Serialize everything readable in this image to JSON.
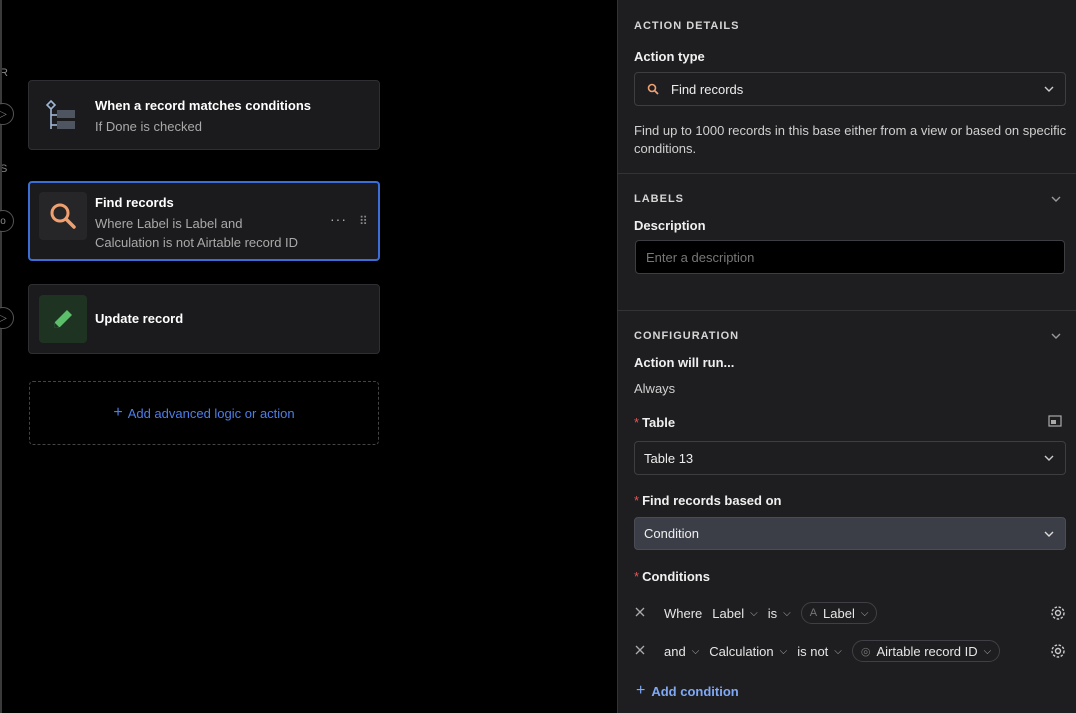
{
  "canvas": {
    "edge_fragments": [
      "R",
      "S",
      "o"
    ],
    "cards": [
      {
        "title": "When a record matches conditions",
        "subtitle": "If Done is checked",
        "icon": "trigger-condition-icon"
      },
      {
        "title": "Find records",
        "subtitle_line1": "Where Label is Label and",
        "subtitle_line2": "Calculation is not Airtable record ID",
        "icon": "search-icon",
        "more": "···",
        "grip": "⠿"
      },
      {
        "title": "Update record",
        "icon": "pencil-icon"
      }
    ],
    "add_action_label": "Add advanced logic or action"
  },
  "panel": {
    "action_details": {
      "section_title": "ACTION DETAILS",
      "action_type_label": "Action type",
      "action_type_value": "Find records",
      "description": "Find up to 1000 records in this base either from a view or based on specific conditions."
    },
    "labels": {
      "section_title": "LABELS",
      "description_label": "Description",
      "description_placeholder": "Enter a description"
    },
    "configuration": {
      "section_title": "CONFIGURATION",
      "action_run_label": "Action will run...",
      "action_run_value": "Always",
      "table_label": "Table",
      "table_value": "Table 13",
      "find_based_label": "Find records based on",
      "find_based_value": "Condition",
      "conditions_label": "Conditions",
      "conditions": [
        {
          "connector": "Where",
          "field": "Label",
          "operator": "is",
          "value": "Label"
        },
        {
          "connector": "and",
          "field": "Calculation",
          "operator": "is not",
          "value": "Airtable record ID"
        }
      ],
      "add_condition_label": "Add condition",
      "required_mark": "*"
    }
  },
  "colors": {
    "accent": "#3b6fd6",
    "link": "#4d7fe8",
    "search_icon": "#f0a070",
    "pencil_icon": "#5cc06a",
    "required": "#e05a5a"
  }
}
